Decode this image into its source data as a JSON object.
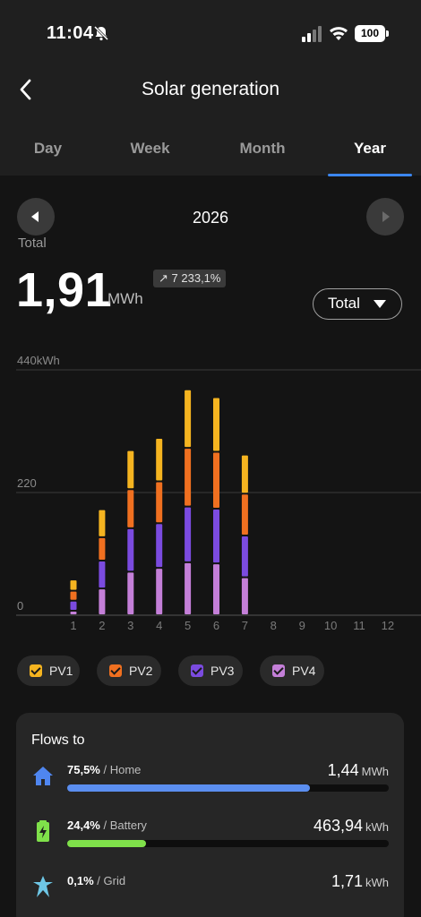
{
  "status_bar": {
    "time": "11:04",
    "battery": "100"
  },
  "header": {
    "title": "Solar generation",
    "tabs": [
      {
        "label": "Day",
        "active": false
      },
      {
        "label": "Week",
        "active": false
      },
      {
        "label": "Month",
        "active": false
      },
      {
        "label": "Year",
        "active": true
      }
    ]
  },
  "period": {
    "year": "2026"
  },
  "summary": {
    "label": "Total",
    "value": "1,91",
    "unit": "MWh",
    "trend": "7 233,1%",
    "filter": "Total"
  },
  "chart_data": {
    "type": "bar",
    "stacked": true,
    "categories": [
      "1",
      "2",
      "3",
      "4",
      "5",
      "6",
      "7",
      "8",
      "9",
      "10",
      "11",
      "12"
    ],
    "y_ticks": [
      "0",
      "220",
      "440kWh"
    ],
    "ylim": [
      0,
      440
    ],
    "series": [
      {
        "name": "PV4",
        "color": "#c47fd8",
        "values": [
          8,
          48,
          78,
          85,
          95,
          93,
          68,
          0,
          0,
          0,
          0,
          0
        ]
      },
      {
        "name": "PV3",
        "color": "#7b4be0",
        "values": [
          18,
          50,
          78,
          80,
          100,
          98,
          75,
          0,
          0,
          0,
          0,
          0
        ]
      },
      {
        "name": "PV2",
        "color": "#f07020",
        "values": [
          18,
          42,
          70,
          75,
          105,
          102,
          75,
          0,
          0,
          0,
          0,
          0
        ]
      },
      {
        "name": "PV1",
        "color": "#f5b420",
        "values": [
          20,
          50,
          70,
          78,
          105,
          98,
          70,
          0,
          0,
          0,
          0,
          0
        ]
      }
    ]
  },
  "legend": [
    {
      "label": "PV1",
      "color": "#f5b420"
    },
    {
      "label": "PV2",
      "color": "#f07020"
    },
    {
      "label": "PV3",
      "color": "#7b4be0"
    },
    {
      "label": "PV4",
      "color": "#c47fd8"
    }
  ],
  "flows": {
    "title": "Flows to",
    "items": [
      {
        "pct": "75,5%",
        "name": "Home",
        "value": "1,44",
        "unit": "MWh",
        "share": 0.755,
        "color": "#5b8ef0"
      },
      {
        "pct": "24,4%",
        "name": "Battery",
        "value": "463,94",
        "unit": "kWh",
        "share": 0.244,
        "color": "#7fe04a"
      },
      {
        "pct": "0,1%",
        "name": "Grid",
        "value": "1,71",
        "unit": "kWh",
        "share": 0.001,
        "color": "#6ec7e6"
      }
    ]
  },
  "icons": {
    "back": "chevron-left-icon",
    "prev": "triangle-left-icon",
    "next": "triangle-right-icon",
    "home": "home-icon",
    "battery": "battery-charging-icon",
    "grid": "grid-tower-icon"
  }
}
